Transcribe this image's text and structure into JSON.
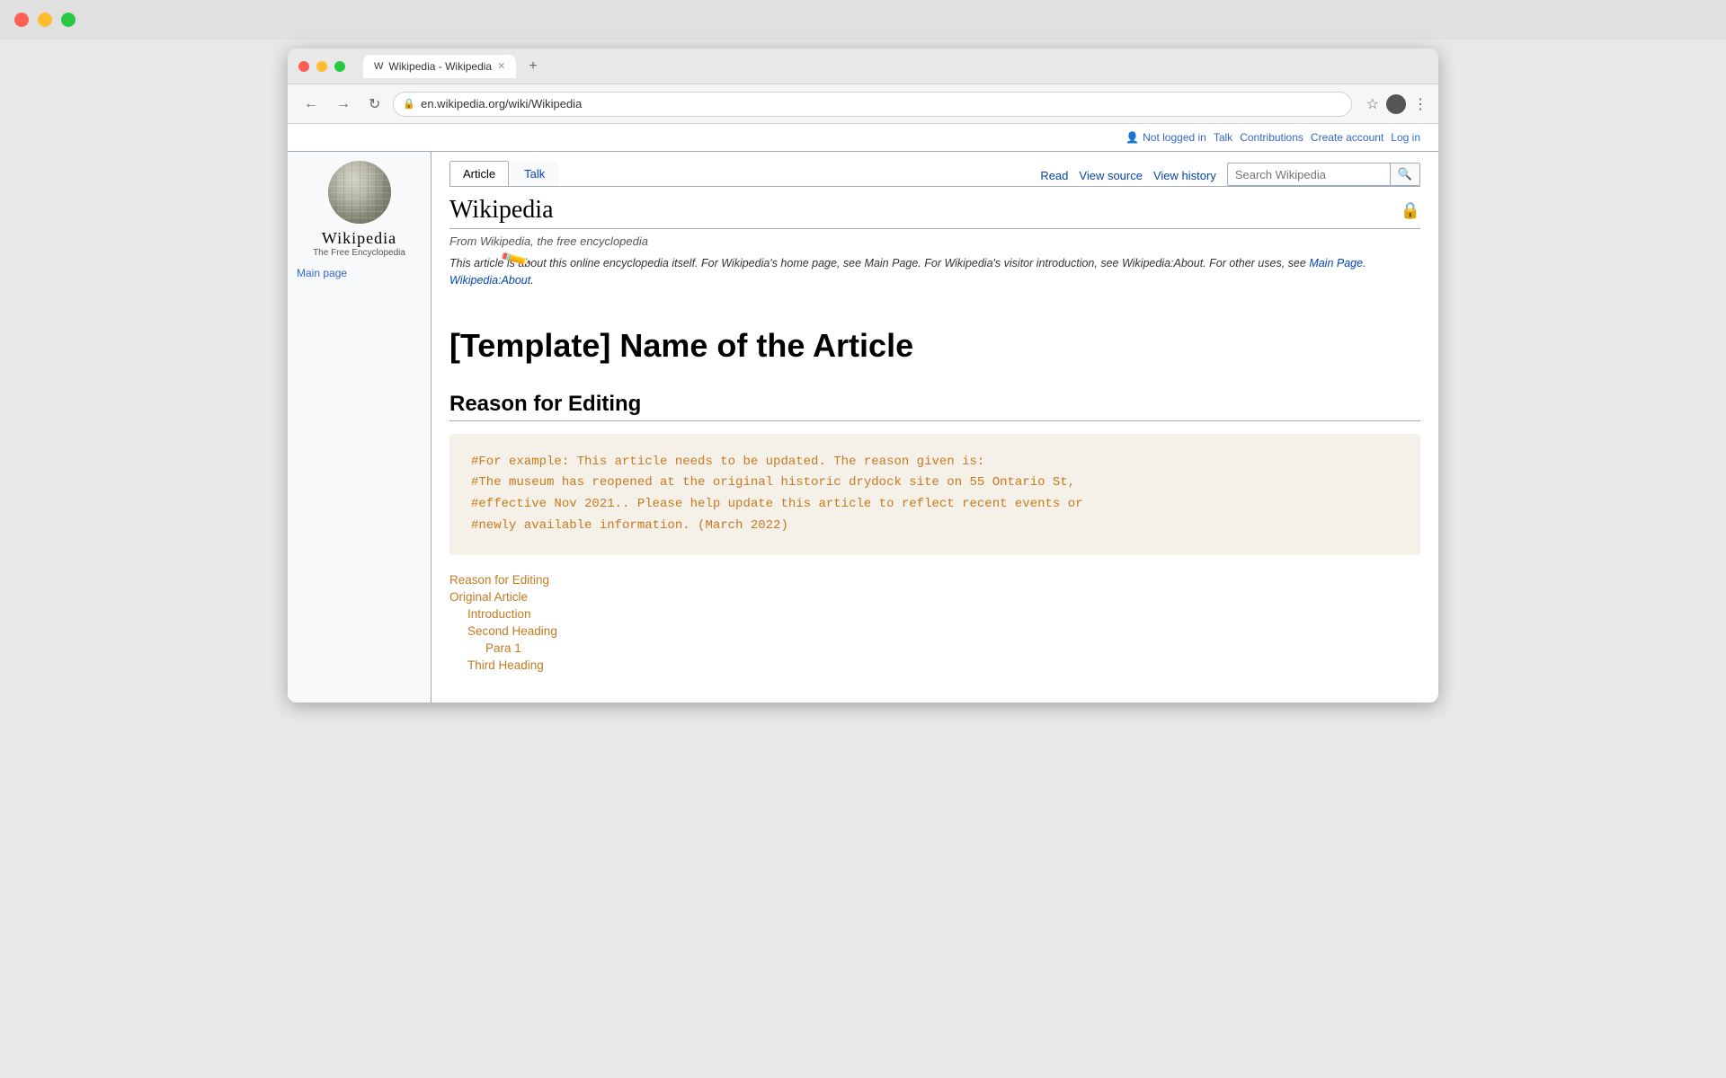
{
  "os": {
    "dots": [
      "red",
      "yellow",
      "green"
    ]
  },
  "browser": {
    "tab_title": "Wikipedia - Wikipedia",
    "tab_favicon": "W",
    "address": "en.wikipedia.org/wiki/Wikipedia",
    "add_tab_label": "+",
    "back_label": "←",
    "forward_label": "→",
    "refresh_label": "↻"
  },
  "wiki": {
    "header": {
      "not_logged_in": "Not logged in",
      "talk": "Talk",
      "contributions": "Contributions",
      "create_account": "Create account",
      "log_in": "Log in"
    },
    "logo": {
      "wordmark": "Wikipedia",
      "tagline": "The Free Encyclopedia"
    },
    "sidebar": {
      "main_page_link": "Main page"
    },
    "tabs": {
      "article": "Article",
      "talk": "Talk",
      "read": "Read",
      "view_source": "View source",
      "view_history": "View history",
      "search_placeholder": "Search Wikipedia"
    },
    "article": {
      "title": "Wikipedia",
      "subtitle": "From Wikipedia, the free encyclopedia",
      "notice": "This article is about this online encyclopedia itself. For Wikipedia's home page, see Main Page. For Wikipedia's visitor introduction, see Wikipedia:About. For other uses, see",
      "main_title": "[Template] Name of the Article",
      "section1_heading": "Reason for Editing",
      "code_block": "#For example: This article needs to be updated. The reason given is:\n#The museum has reopened at the original historic drydock site on 55 Ontario St,\n#effective Nov 2021.. Please help update this article to reflect recent events or\n#newly available information. (March 2022)"
    },
    "toc": {
      "items": [
        {
          "label": "Reason for Editing",
          "indent": 0
        },
        {
          "label": "Original Article",
          "indent": 0
        },
        {
          "label": "Introduction",
          "indent": 1
        },
        {
          "label": "Second Heading",
          "indent": 1
        },
        {
          "label": "Para 1",
          "indent": 2
        },
        {
          "label": "Third Heading",
          "indent": 1
        }
      ]
    }
  }
}
